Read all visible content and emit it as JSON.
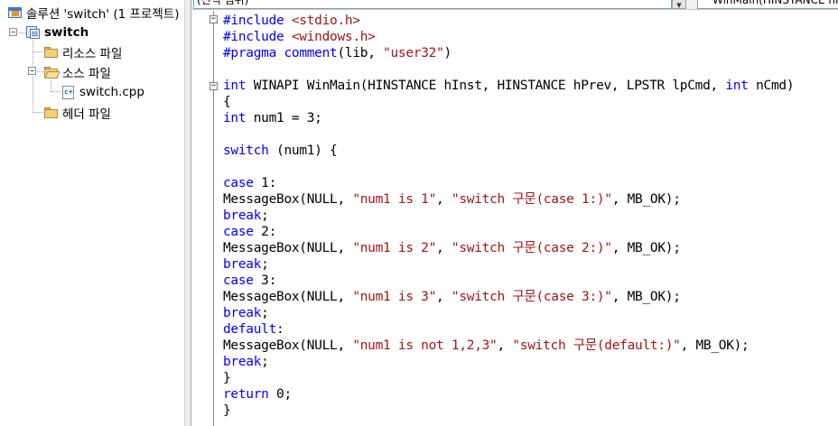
{
  "solution_explorer": {
    "solution_label": "솔루션 'switch' (1 프로젝트)",
    "project_label": "switch",
    "folders": {
      "resources": "리소스 파일",
      "sources": "소스 파일",
      "headers": "헤더 파일"
    },
    "source_file": "switch.cpp"
  },
  "navbar": {
    "scope_combo": "(전역 범위)",
    "function_combo": "WinMain(HINSTANCE hInst, HINSTANCE hPrev, LPSTR lpCmd, int nCmd)"
  },
  "editor": {
    "lines": [
      {
        "parts": [
          {
            "t": "#include ",
            "c": "pp"
          },
          {
            "t": "<stdio.h>",
            "c": "str"
          }
        ]
      },
      {
        "parts": [
          {
            "t": "#include ",
            "c": "pp"
          },
          {
            "t": "<windows.h>",
            "c": "str"
          }
        ]
      },
      {
        "parts": [
          {
            "t": "#pragma ",
            "c": "pp"
          },
          {
            "t": "comment",
            "c": "pp"
          },
          {
            "t": "(lib, ",
            "c": ""
          },
          {
            "t": "\"user32\"",
            "c": "str"
          },
          {
            "t": ")",
            "c": ""
          }
        ]
      },
      {
        "parts": []
      },
      {
        "parts": [
          {
            "t": "int",
            "c": "kw"
          },
          {
            "t": " WINAPI WinMain(HINSTANCE hInst, HINSTANCE hPrev, LPSTR lpCmd, ",
            "c": ""
          },
          {
            "t": "int",
            "c": "kw"
          },
          {
            "t": " nCmd)",
            "c": ""
          }
        ]
      },
      {
        "parts": [
          {
            "t": "{",
            "c": ""
          }
        ]
      },
      {
        "parts": [
          {
            "t": "int",
            "c": "kw"
          },
          {
            "t": " num1 = 3;",
            "c": ""
          }
        ]
      },
      {
        "parts": []
      },
      {
        "parts": [
          {
            "t": "switch",
            "c": "kw"
          },
          {
            "t": " (num1) {",
            "c": ""
          }
        ]
      },
      {
        "parts": []
      },
      {
        "parts": [
          {
            "t": "case",
            "c": "kw"
          },
          {
            "t": " 1:",
            "c": ""
          }
        ]
      },
      {
        "parts": [
          {
            "t": "MessageBox(NULL, ",
            "c": ""
          },
          {
            "t": "\"num1 is 1\"",
            "c": "str"
          },
          {
            "t": ", ",
            "c": ""
          },
          {
            "t": "\"switch 구문(case 1:)\"",
            "c": "str"
          },
          {
            "t": ", MB_OK);",
            "c": ""
          }
        ]
      },
      {
        "parts": [
          {
            "t": "break",
            "c": "kw"
          },
          {
            "t": ";",
            "c": ""
          }
        ]
      },
      {
        "parts": [
          {
            "t": "case",
            "c": "kw"
          },
          {
            "t": " 2:",
            "c": ""
          }
        ]
      },
      {
        "parts": [
          {
            "t": "MessageBox(NULL, ",
            "c": ""
          },
          {
            "t": "\"num1 is 2\"",
            "c": "str"
          },
          {
            "t": ", ",
            "c": ""
          },
          {
            "t": "\"switch 구문(case 2:)\"",
            "c": "str"
          },
          {
            "t": ", MB_OK);",
            "c": ""
          }
        ]
      },
      {
        "parts": [
          {
            "t": "break",
            "c": "kw"
          },
          {
            "t": ";",
            "c": ""
          }
        ]
      },
      {
        "parts": [
          {
            "t": "case",
            "c": "kw"
          },
          {
            "t": " 3:",
            "c": ""
          }
        ]
      },
      {
        "parts": [
          {
            "t": "MessageBox(NULL, ",
            "c": ""
          },
          {
            "t": "\"num1 is 3\"",
            "c": "str"
          },
          {
            "t": ", ",
            "c": ""
          },
          {
            "t": "\"switch 구문(case 3:)\"",
            "c": "str"
          },
          {
            "t": ", MB_OK);",
            "c": ""
          }
        ]
      },
      {
        "parts": [
          {
            "t": "break",
            "c": "kw"
          },
          {
            "t": ";",
            "c": ""
          }
        ]
      },
      {
        "parts": [
          {
            "t": "default",
            "c": "kw"
          },
          {
            "t": ":",
            "c": ""
          }
        ]
      },
      {
        "parts": [
          {
            "t": "MessageBox(NULL, ",
            "c": ""
          },
          {
            "t": "\"num1 is not 1,2,3\"",
            "c": "str"
          },
          {
            "t": ", ",
            "c": ""
          },
          {
            "t": "\"switch 구문(default:)\"",
            "c": "str"
          },
          {
            "t": ", MB_OK);",
            "c": ""
          }
        ]
      },
      {
        "parts": [
          {
            "t": "break",
            "c": "kw"
          },
          {
            "t": ";",
            "c": ""
          }
        ]
      },
      {
        "parts": [
          {
            "t": "}",
            "c": ""
          }
        ]
      },
      {
        "parts": [
          {
            "t": "return",
            "c": "kw"
          },
          {
            "t": " 0;",
            "c": ""
          }
        ]
      },
      {
        "parts": [
          {
            "t": "}",
            "c": ""
          }
        ]
      }
    ]
  }
}
